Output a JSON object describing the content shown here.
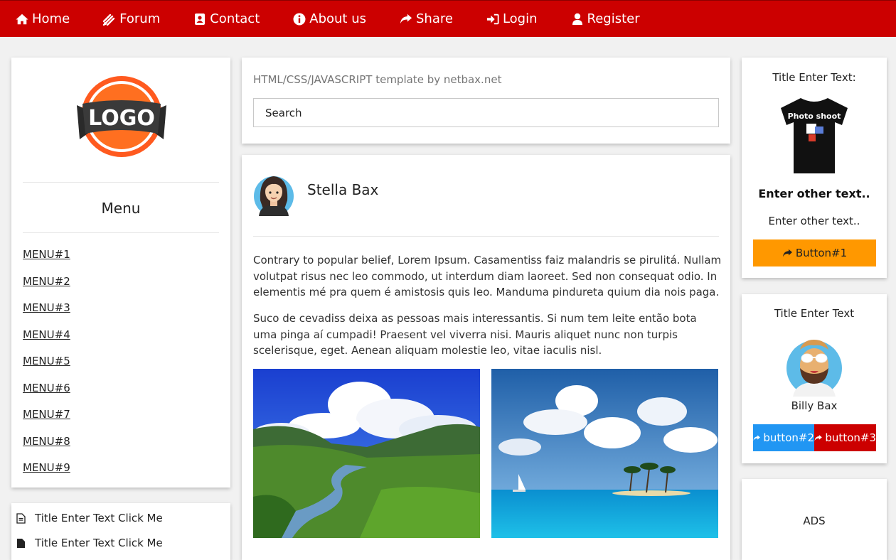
{
  "nav": {
    "items": [
      {
        "label": "Home",
        "icon": "home-icon"
      },
      {
        "label": "Forum",
        "icon": "forum-icon"
      },
      {
        "label": "Contact",
        "icon": "contact-icon"
      },
      {
        "label": "About us",
        "icon": "info-icon"
      },
      {
        "label": "Share",
        "icon": "share-icon"
      },
      {
        "label": "Login",
        "icon": "login-icon"
      },
      {
        "label": "Register",
        "icon": "user-icon"
      }
    ]
  },
  "sidebar": {
    "logo_text": "LOGO",
    "menu_title": "Menu",
    "menu_items": [
      "MENU#1",
      "MENU#2",
      "MENU#3",
      "MENU#4",
      "MENU#5",
      "MENU#6",
      "MENU#7",
      "MENU#8",
      "MENU#9"
    ],
    "links": [
      "Title Enter Text Click Me",
      "Title Enter Text Click Me"
    ]
  },
  "search": {
    "template_text": "HTML/CSS/JAVASCRIPT template by netbax.net",
    "placeholder": "Search"
  },
  "post": {
    "author": "Stella Bax",
    "paragraphs": [
      "Contrary to popular belief, Lorem Ipsum. Casamentiss faiz malandris se pirulitá. Nullam volutpat risus nec leo commodo, ut interdum diam laoreet. Sed non consequat odio. In elementis mé pra quem é amistosis quis leo. Manduma pindureta quium dia nois paga.",
      "Suco de cevadiss deixa as pessoas mais interessantis. Si num tem leite então bota uma pinga aí cumpadi! Praesent vel viverra nisi. Mauris aliquet nunc non turpis scelerisque, eget. Aenean aliquam molestie leo, vitae iaculis nisl."
    ]
  },
  "right": {
    "card1": {
      "title": "Title Enter Text:",
      "tshirt_text": "Photo shoot",
      "bold_text": "Enter other text..",
      "plain_text": "Enter other text..",
      "button": "Button#1"
    },
    "card2": {
      "title": "Title Enter Text",
      "name": "Billy Bax",
      "button2": "button#2",
      "button3": "button#3"
    },
    "card3": {
      "ads": "ADS"
    }
  },
  "colors": {
    "nav_bg": "#cc0000",
    "button1": "#ff9800",
    "button2": "#2196f3",
    "button3": "#cc0000"
  }
}
